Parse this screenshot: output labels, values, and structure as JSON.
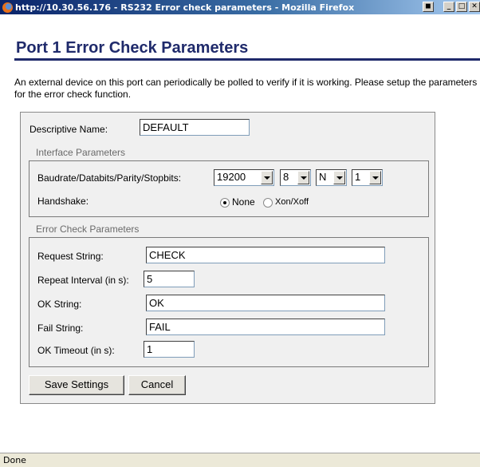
{
  "window": {
    "title": "http://10.30.56.176 - RS232 Error check parameters - Mozilla Firefox"
  },
  "page": {
    "title": "Port 1 Error Check Parameters",
    "intro": "An external device on this port can periodically be polled to verify if it is working. Please setup the parameters for the error check function."
  },
  "form": {
    "descriptive_name_label": "Descriptive Name:",
    "descriptive_name_value": "DEFAULT",
    "interface": {
      "legend": "Interface Parameters",
      "serial_label": "Baudrate/Databits/Parity/Stopbits:",
      "baudrate": "19200",
      "databits": "8",
      "parity": "N",
      "stopbits": "1",
      "handshake_label": "Handshake:",
      "handshake_none": "None",
      "handshake_xon": "Xon/Xoff"
    },
    "error_check": {
      "legend": "Error Check Parameters",
      "request_label": "Request String:",
      "request_value": "CHECK",
      "repeat_label": "Repeat Interval (in s):",
      "repeat_value": "5",
      "ok_label": "OK String:",
      "ok_value": "OK",
      "fail_label": "Fail String:",
      "fail_value": "FAIL",
      "timeout_label": "OK Timeout (in s):",
      "timeout_value": "1"
    },
    "save_button": "Save Settings",
    "cancel_button": "Cancel"
  },
  "status": {
    "text": "Done"
  }
}
